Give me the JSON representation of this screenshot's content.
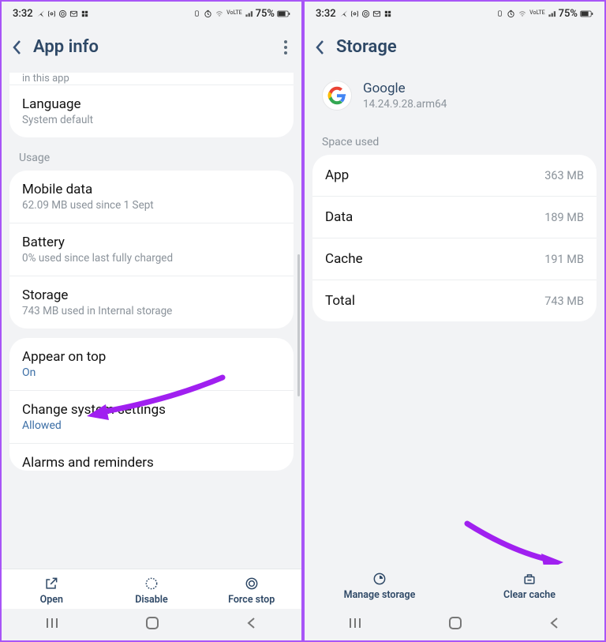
{
  "status": {
    "time": "3:32",
    "battery": "75%"
  },
  "left": {
    "header": "App info",
    "topCut": "in this app",
    "items": {
      "language": {
        "title": "Language",
        "sub": "System default"
      },
      "sectionUsage": "Usage",
      "mobileData": {
        "title": "Mobile data",
        "sub": "62.09 MB used since 1 Sept"
      },
      "battery": {
        "title": "Battery",
        "sub": "0% used since last fully charged"
      },
      "storage": {
        "title": "Storage",
        "sub": "743 MB used in Internal storage"
      },
      "appearOnTop": {
        "title": "Appear on top",
        "sub": "On"
      },
      "changeSettings": {
        "title": "Change system settings",
        "sub": "Allowed"
      },
      "alarms": {
        "title": "Alarms and reminders"
      }
    },
    "actions": {
      "open": "Open",
      "disable": "Disable",
      "force": "Force stop"
    }
  },
  "right": {
    "header": "Storage",
    "app": {
      "name": "Google",
      "version": "14.24.9.28.arm64"
    },
    "sectionSpace": "Space used",
    "rows": {
      "app": {
        "key": "App",
        "val": "363 MB"
      },
      "data": {
        "key": "Data",
        "val": "189 MB"
      },
      "cache": {
        "key": "Cache",
        "val": "191 MB"
      },
      "total": {
        "key": "Total",
        "val": "743 MB"
      }
    },
    "actions": {
      "manage": "Manage storage",
      "clear": "Clear cache"
    }
  }
}
